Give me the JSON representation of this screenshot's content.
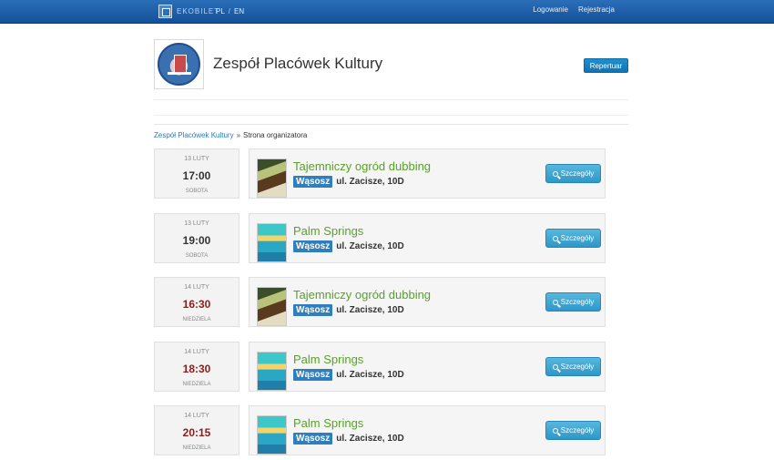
{
  "header": {
    "brand": "EKOBILET",
    "lang_pl": "PL",
    "lang_sep": "/",
    "lang_en": "EN",
    "login": "Logowanie",
    "register": "Rejestracja"
  },
  "organizer": {
    "title": "Zespół Placówek Kultury",
    "repertuar_button": "Repertuar"
  },
  "breadcrumb": {
    "link": "Zespół Placówek Kultury",
    "separator": "»",
    "current": "Strona organizatora"
  },
  "colors": {
    "topbar": "#1a5ea8",
    "title_green": "#5aa02c",
    "badge_blue": "#2f7fbf",
    "time_red": "#8c1c1c"
  },
  "events": [
    {
      "day": "13 LUTY",
      "time": "17:00",
      "weekday": "SOBOTA",
      "title": "Tajemniczy ogród dubbing",
      "city": "Wąsosz",
      "address": "ul. Zacisze, 10D",
      "details": "Szczegóły"
    },
    {
      "day": "13 LUTY",
      "time": "19:00",
      "weekday": "SOBOTA",
      "title": "Palm Springs",
      "city": "Wąsosz",
      "address": "ul. Zacisze, 10D",
      "details": "Szczegóły"
    },
    {
      "day": "14 LUTY",
      "time": "16:30",
      "weekday": "NIEDZIELA",
      "title": "Tajemniczy ogród dubbing",
      "city": "Wąsosz",
      "address": "ul. Zacisze, 10D",
      "details": "Szczegóły"
    },
    {
      "day": "14 LUTY",
      "time": "18:30",
      "weekday": "NIEDZIELA",
      "title": "Palm Springs",
      "city": "Wąsosz",
      "address": "ul. Zacisze, 10D",
      "details": "Szczegóły"
    },
    {
      "day": "14 LUTY",
      "time": "20:15",
      "weekday": "NIEDZIELA",
      "title": "Palm Springs",
      "city": "Wąsosz",
      "address": "ul. Zacisze, 10D",
      "details": "Szczegóły"
    }
  ]
}
